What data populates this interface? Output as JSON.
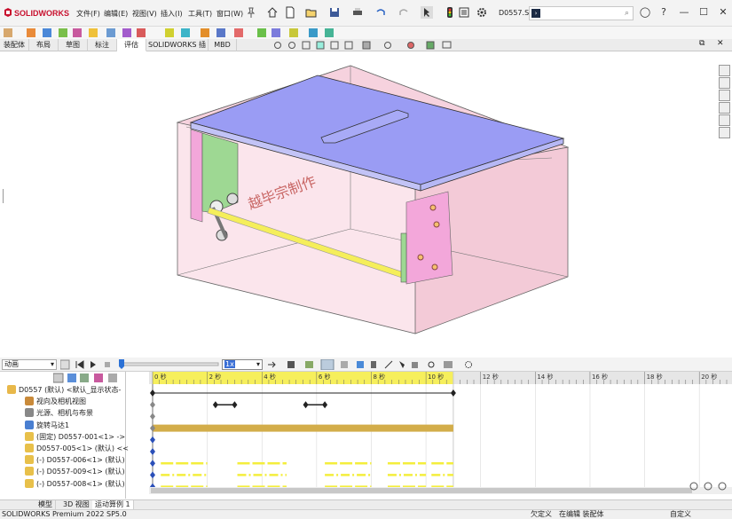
{
  "app": {
    "logo_text": "SOLIDWORKS",
    "menus": [
      "文件(F)",
      "编辑(E)",
      "视图(V)",
      "插入(I)",
      "工具(T)",
      "窗口(W)"
    ],
    "document_name": "D0557.S...",
    "search_value": "",
    "window_buttons": [
      "—",
      "☐",
      "✕"
    ]
  },
  "tabs": [
    "装配体",
    "布局",
    "草图",
    "标注",
    "评估",
    "SOLIDWORKS 插件",
    "MBD"
  ],
  "active_tab": 4,
  "graphics": {
    "watermark": "越毕宗制作",
    "colors": {
      "top_plate": "#9a9cf4",
      "box": "#f7d9e3",
      "shaft": "#f5ee5a",
      "green": "#8fd98a",
      "pink": "#f3a7da"
    }
  },
  "motion": {
    "study_type": "动画",
    "speed": "1x",
    "tree": [
      {
        "label": "D0557 (默认) <默认_显示状态-",
        "icon": "assembly-icon",
        "level": 0
      },
      {
        "label": "视向及相机视图",
        "icon": "camera-view-icon",
        "level": 1
      },
      {
        "label": "光源、相机与布景",
        "icon": "lights-icon",
        "level": 1
      },
      {
        "label": "旋转马达1",
        "icon": "rotary-motor-icon",
        "level": 1
      },
      {
        "label": "(固定) D0557-001<1> ->",
        "icon": "part-icon",
        "level": 1
      },
      {
        "label": "D0557-005<1> (默认) <<",
        "icon": "part-icon",
        "level": 1
      },
      {
        "label": "(-) D0557-006<1> (默认)",
        "icon": "part-icon",
        "level": 1
      },
      {
        "label": "(-) D0557-009<1> (默认)",
        "icon": "part-icon",
        "level": 1
      },
      {
        "label": "(-) D0557-008<1> (默认)",
        "icon": "part-icon",
        "level": 1
      }
    ],
    "time_ticks": [
      "0 秒",
      "2 秒",
      "4 秒",
      "6 秒",
      "8 秒",
      "10 秒",
      "12 秒",
      "14 秒",
      "16 秒",
      "18 秒",
      "20 秒"
    ],
    "time_end_seconds": 11,
    "time_range_seconds": [
      0,
      21
    ],
    "motor_bar_seconds": [
      0,
      11
    ],
    "keyframe_pairs_row1": [
      [
        2.3,
        3
      ],
      [
        5.6,
        6.3
      ]
    ]
  },
  "bottom_tabs": [
    "模型",
    "3D 视图",
    "运动算例 1"
  ],
  "active_bottom_tab": 2,
  "status": {
    "product": "SOLIDWORKS Premium 2022 SP5.0",
    "defined": "欠定义",
    "editing": "在编辑 装配体",
    "custom": "自定义"
  }
}
